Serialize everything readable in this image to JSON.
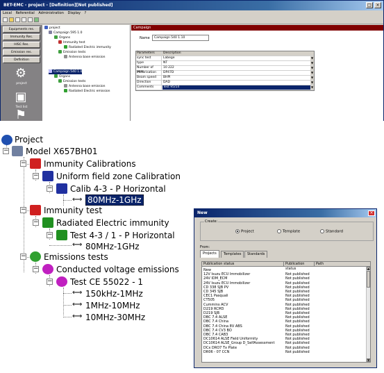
{
  "app": {
    "title": "BET-EMC - project - [Definition][Not published]",
    "menu": [
      "Local",
      "Referential",
      "Administration",
      "Display",
      "?"
    ],
    "nav_buttons": [
      "Equipments res.",
      "Immunity Res.",
      "HISC Res.",
      "Emission res.",
      "Definition"
    ],
    "nav_items": [
      "project",
      "Test list"
    ],
    "tree": [
      {
        "label": "project",
        "level": 0
      },
      {
        "label": "Campaign 595 1.0",
        "level": 1
      },
      {
        "label": "Organs",
        "level": 2
      },
      {
        "label": "Immunity test",
        "level": 3
      },
      {
        "label": "Radiated Electric immunity",
        "level": 4
      },
      {
        "label": "Emission tests",
        "level": 3
      },
      {
        "label": "Antenna base emission",
        "level": 4
      },
      {
        "label": "Campaign 540 1.0",
        "level": 1,
        "selected": true
      },
      {
        "label": "Organs",
        "level": 2
      },
      {
        "label": "Emission tests",
        "level": 3
      },
      {
        "label": "Antenna base emission",
        "level": 4
      },
      {
        "label": "Radiated Electric emission",
        "level": 4
      }
    ],
    "form": {
      "header": "Campaign",
      "name_label": "Name",
      "name_value": "Campaign 540 1.10",
      "params_header": [
        "Parameters",
        "Description"
      ],
      "params": [
        {
          "k": "sync test",
          "v": "Labege"
        },
        {
          "k": "type",
          "v": "NT"
        },
        {
          "k": "Number of pers",
          "v": "10 222"
        },
        {
          "k": "Motorisation",
          "v": "DP47D"
        },
        {
          "k": "Beam speed",
          "v": "BHPI"
        },
        {
          "k": "Direction",
          "v": "DAD"
        },
        {
          "k": "Comments",
          "v": "Test 95/14",
          "selected": true
        }
      ]
    }
  },
  "tree": {
    "root": "Project",
    "model": "Model X657BH01",
    "immunity_cal": "Immunity Calibrations",
    "uniform": "Uniform field zone Calibration",
    "calib": "Calib 4-3 - P Horizontal",
    "calib_freq": "80MHz-1GHz",
    "immunity_test": "Immunity test",
    "radiated": "Radiated Electric immunity",
    "test43": "Test 4-3 / 1 - P Horizontal",
    "test43_freq": "80MHz-1GHz",
    "emission": "Emissions tests",
    "conducted": "Conducted voltage emissions",
    "ce": "Test CE 55022 - 1",
    "ce_freqs": [
      "150kHz-1MHz",
      "1MHz-10MHz",
      "10MHz-30MHz"
    ]
  },
  "dialog": {
    "title": "New",
    "create_label": "Create:",
    "radios": [
      "Project",
      "Template",
      "Standard"
    ],
    "from_label": "From:",
    "tabs": [
      "Projects",
      "Templates",
      "Standards"
    ],
    "columns": [
      "Publication status",
      "Publication status",
      "Path"
    ],
    "rows": [
      [
        "New",
        ""
      ],
      [
        "12V Isuzu ECU Immobilizer",
        "Not published"
      ],
      [
        "24V IDM_ECM",
        "Not published"
      ],
      [
        "24V Isuzu ECU Immobilizer",
        "Not published"
      ],
      [
        "CD 338 SJB PV",
        "Not published"
      ],
      [
        "CD 345 SJB",
        "Not published"
      ],
      [
        "CEC1 Pasquali",
        "Not published"
      ],
      [
        "CT505",
        "Not published"
      ],
      [
        "Cummins ACV",
        "Not published"
      ],
      [
        "D219 RCM3",
        "Not published"
      ],
      [
        "D219 SJB",
        "Not published"
      ],
      [
        "DBC 7.4 ALSE",
        "Not published"
      ],
      [
        "DBC 7.4 China",
        "Not published"
      ],
      [
        "DBC 7.4 China 8V ABS",
        "Not published"
      ],
      [
        "DBC 7.4 CV3 BO",
        "Not published"
      ],
      [
        "DBC 7.4 CAB3",
        "Not published"
      ],
      [
        "DC10614 ALSE Field Uniformity",
        "Not published"
      ],
      [
        "DC10614 ALSE_Group D_SelfAssessment",
        "Not published"
      ],
      [
        "DCx DRO7 Tx Plate",
        "Not published"
      ],
      [
        "DR06 - 07 CCN",
        "Not published"
      ]
    ]
  },
  "colors": {
    "titlebar": "#0a246a",
    "campaign_header": "#800000",
    "selection": "#0a246a"
  }
}
